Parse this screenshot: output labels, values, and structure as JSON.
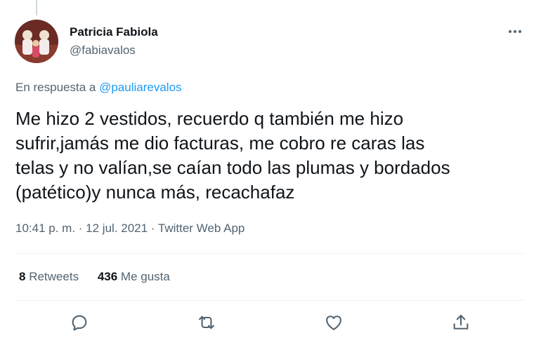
{
  "author": {
    "name": "Patricia Fabiola",
    "handle": "@fabiavalos",
    "avatar_icon": "profile-photo"
  },
  "reply": {
    "prefix": "En respuesta a",
    "mention": "@pauliarevalos"
  },
  "tweet": {
    "text": "Me hizo 2 vestidos, recuerdo q también me hizo\nsufrir,jamás me dio facturas, me cobro re caras las\ntelas y no valían,se caían todo las plumas y bordados\n(patético)y nunca más, recachafaz"
  },
  "meta": {
    "time": "10:41 p. m.",
    "separator1": " · ",
    "date": "12 jul. 2021",
    "separator2": " · ",
    "app": "Twitter Web App"
  },
  "stats": {
    "retweets_count": "8",
    "retweets_label": "Retweets",
    "likes_count": "436",
    "likes_label": "Me gusta"
  },
  "actions": [
    "reply-icon",
    "retweet-icon",
    "like-icon",
    "share-icon"
  ],
  "colors": {
    "accent": "#1d9bf0",
    "text": "#0f1419",
    "secondary": "#536471",
    "divider": "#eff3f4"
  }
}
